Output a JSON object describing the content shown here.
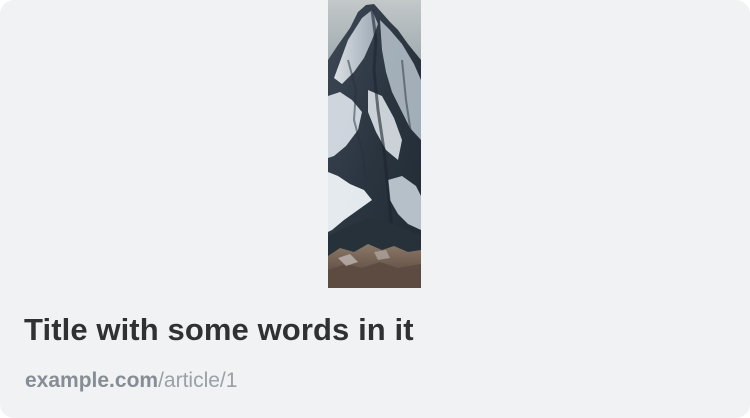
{
  "card": {
    "image": {
      "icon": "mountain-photo",
      "colors": {
        "sky": "#9aa6ab",
        "rock_dark": "#2e3a45",
        "snow": "#d7dee5",
        "foothills": "#6e5a50"
      }
    },
    "title": "Title with some words in it",
    "link": {
      "domain": "example.com",
      "path": "/article/1"
    },
    "colors": {
      "background": "#f1f2f4",
      "title": "#2f3133",
      "url": "#8a9198"
    }
  }
}
